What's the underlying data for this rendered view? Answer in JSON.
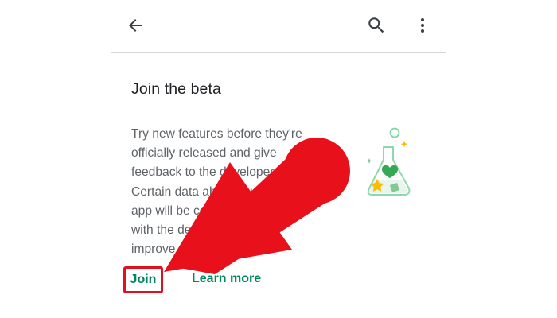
{
  "header": {
    "back_icon": "arrow-left-icon",
    "search_icon": "search-icon",
    "menu_icon": "more-vert-icon"
  },
  "card": {
    "title": "Join the beta",
    "description_lines": [
      "Try new features before they're",
      "officially released and give",
      "feedback to the developer.",
      "Certain data about your use of the",
      "app will be collected and shared",
      "with the developer to help",
      "improve the app."
    ],
    "illustration": "beta-flask-illustration"
  },
  "actions": {
    "join_label": "Join",
    "learn_more_label": "Learn more"
  },
  "overlay": {
    "annotation": "red-arrow-pointer",
    "color": "#e8101b"
  },
  "colors": {
    "accent": "#01875f",
    "highlight": "#e0101f",
    "title": "#202124",
    "body": "#5f6368"
  }
}
